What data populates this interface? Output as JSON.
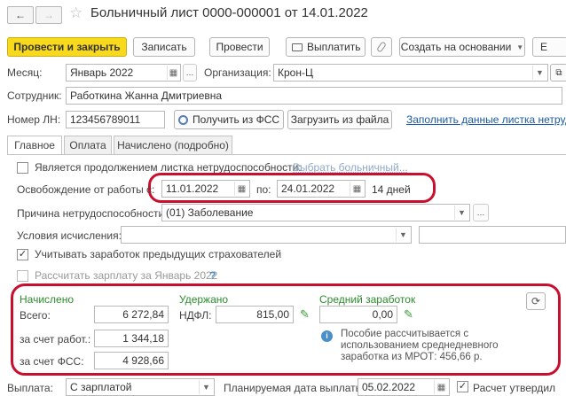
{
  "window": {
    "title": "Больничный лист 0000-000001 от 14.01.2022",
    "nav_back": "←",
    "nav_forward": "→",
    "star": "☆"
  },
  "toolbar": {
    "post_close": "Провести и закрыть",
    "save": "Записать",
    "post": "Провести",
    "pay": "Выплатить",
    "create_based": "Создать на основании",
    "more": "Е"
  },
  "header": {
    "month_label": "Месяц:",
    "month_value": "Январь 2022",
    "org_label": "Организация:",
    "org_value": "Крон-Ц",
    "employee_label": "Сотрудник:",
    "employee_value": "Работкина Жанна Дмитриевна",
    "ln_label": "Номер ЛН:",
    "ln_value": "123456789011",
    "get_fss": "Получить из ФСС",
    "load_file": "Загрузить из файла",
    "fill_link": "Заполнить данные листка нетрудо"
  },
  "tabs": [
    {
      "label": "Главное"
    },
    {
      "label": "Оплата"
    },
    {
      "label": "Начислено (подробно)"
    }
  ],
  "main": {
    "continuation_label": "Является продолжением листка нетрудоспособности:",
    "choose_sick_leave": "Выбрать больничный...",
    "release_label": "Освобождение от работы с:",
    "date_from": "11.01.2022",
    "date_to_label": "по:",
    "date_to": "24.01.2022",
    "days": "14 дней",
    "cause_label": "Причина нетрудоспособности:",
    "cause_value": "(01) Заболевание",
    "conditions_label": "Условия исчисления:",
    "conditions_value": "",
    "prev_insurers_label": "Учитывать заработок предыдущих страхователей",
    "prev_insurers_checked": true,
    "calc_salary_label": "Рассчитать зарплату за Январь 2022",
    "help_mark": "?"
  },
  "summary": {
    "accrued_title": "Начислено",
    "total_label": "Всего:",
    "total_value": "6 272,84",
    "employer_label": "за счет работ.:",
    "employer_value": "1 344,18",
    "fss_label": "за счет ФСС:",
    "fss_value": "4 928,66",
    "withheld_title": "Удержано",
    "ndfl_label": "НДФЛ:",
    "ndfl_value": "815,00",
    "avg_title": "Средний заработок",
    "avg_value": "0,00",
    "info_text_1": "Пособие рассчитывается с",
    "info_text_2": "использованием среднедневного",
    "info_text_3": "заработка из МРОТ: 456,66 р."
  },
  "footer": {
    "payment_label": "Выплата:",
    "payment_value": "С зарплатой",
    "planned_date_label": "Планируемая дата выплаты:",
    "planned_date_value": "05.02.2022",
    "calc_approved_label": "Расчет утвердил",
    "calc_approved_checked": true
  },
  "colors": {
    "primary": "#f9d91c",
    "highlight": "#c8102e",
    "section_title": "#2e8b2e",
    "link": "#1a5aa5"
  }
}
